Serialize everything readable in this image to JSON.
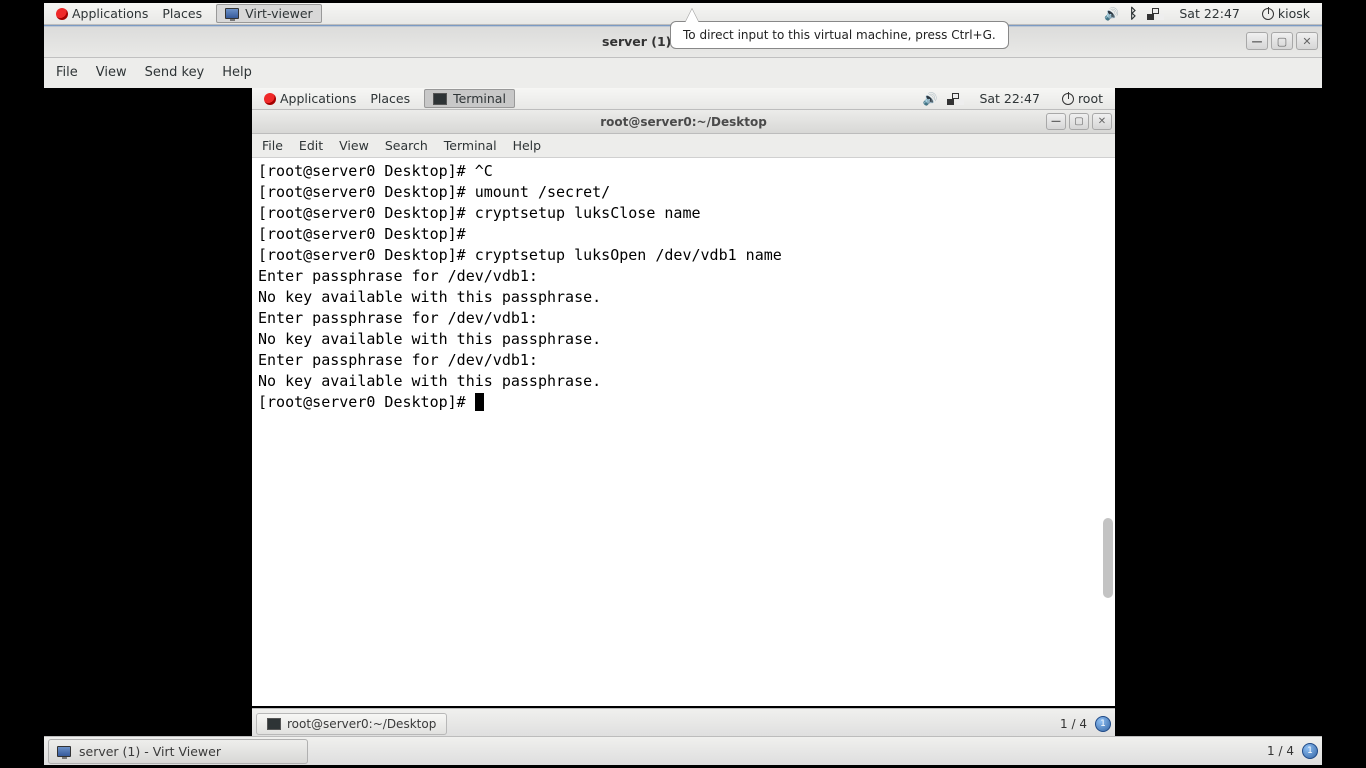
{
  "host_panel": {
    "applications": "Applications",
    "places": "Places",
    "task_virt": "Virt-viewer",
    "datetime": "Sat 22:47",
    "user": "kiosk"
  },
  "virt_window": {
    "title": "server (1) - Virt Viewer",
    "menu": {
      "file": "File",
      "view": "View",
      "sendkey": "Send key",
      "help": "Help"
    },
    "tooltip": "To direct input to this virtual machine, press Ctrl+G."
  },
  "guest_panel": {
    "applications": "Applications",
    "places": "Places",
    "task_term": "Terminal",
    "datetime": "Sat 22:47",
    "user": "root"
  },
  "terminal": {
    "title": "root@server0:~/Desktop",
    "menu": {
      "file": "File",
      "edit": "Edit",
      "view": "View",
      "search": "Search",
      "terminal": "Terminal",
      "help": "Help"
    },
    "lines": [
      "[root@server0 Desktop]# ^C",
      "[root@server0 Desktop]# umount /secret/",
      "[root@server0 Desktop]# cryptsetup luksClose name",
      "[root@server0 Desktop]# ",
      "[root@server0 Desktop]# cryptsetup luksOpen /dev/vdb1 name",
      "Enter passphrase for /dev/vdb1: ",
      "No key available with this passphrase.",
      "Enter passphrase for /dev/vdb1: ",
      "No key available with this passphrase.",
      "Enter passphrase for /dev/vdb1: ",
      "No key available with this passphrase.",
      "[root@server0 Desktop]# "
    ]
  },
  "guest_taskbar": {
    "task": "root@server0:~/Desktop",
    "pager": "1 / 4",
    "pager_n": "1"
  },
  "host_taskbar": {
    "task": "server (1) - Virt Viewer",
    "pager": "1 / 4",
    "pager_n": "1"
  }
}
